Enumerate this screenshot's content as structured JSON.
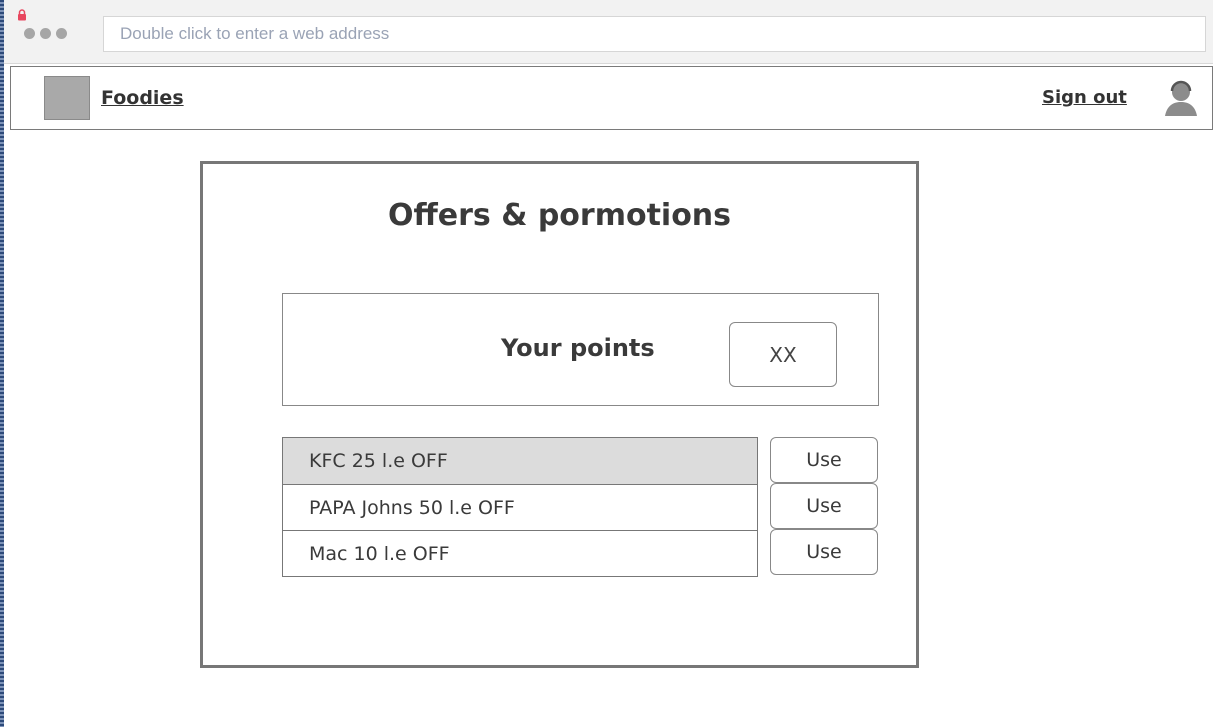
{
  "browser": {
    "address_placeholder": "Double click to enter a web address"
  },
  "header": {
    "brand": "Foodies",
    "signout": "Sign out"
  },
  "panel": {
    "title": "Offers & pormotions",
    "points_label": "Your points",
    "points_value": "XX"
  },
  "offers": [
    {
      "label": "KFC 25 l.e OFF",
      "action": "Use",
      "selected": true
    },
    {
      "label": "PAPA Johns 50 l.e OFF",
      "action": "Use",
      "selected": false
    },
    {
      "label": "Mac 10 l.e OFF",
      "action": "Use",
      "selected": false
    }
  ],
  "icons": {
    "lock": "lock-icon",
    "user": "user-avatar-icon",
    "logo": "logo-placeholder"
  },
  "colors": {
    "selected_row": "#dcdcdc",
    "border": "#777777",
    "lock": "#e8475f"
  }
}
